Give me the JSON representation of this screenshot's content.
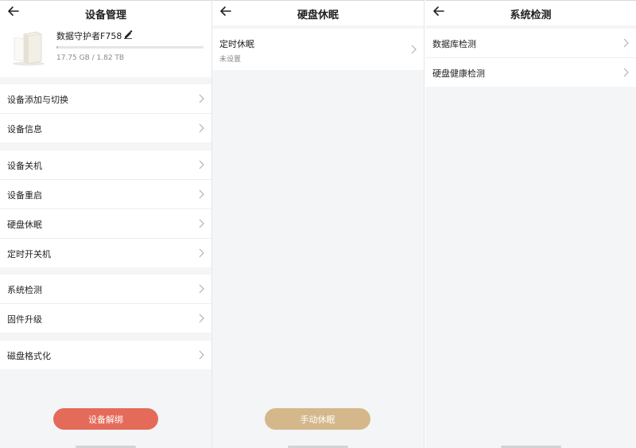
{
  "panels": {
    "device_management": {
      "title": "设备管理",
      "device": {
        "name": "数据守护者F758",
        "storage": "17.75 GB / 1.82 TB",
        "usage_fraction": 0.01
      },
      "groups": [
        [
          "设备添加与切换",
          "设备信息"
        ],
        [
          "设备关机",
          "设备重启",
          "硬盘休眠",
          "定时开关机"
        ],
        [
          "系统检测",
          "固件升级"
        ],
        [
          "磁盘格式化"
        ]
      ],
      "button": "设备解绑"
    },
    "disk_sleep": {
      "title": "硬盘休眠",
      "item": {
        "label": "定时休眠",
        "sub": "未设置"
      },
      "button": "手动休眠"
    },
    "system_check": {
      "title": "系统检测",
      "items": [
        "数据库检测",
        "硬盘健康检测"
      ]
    }
  },
  "colors": {
    "unbind_button": "#e46b5a",
    "sleep_button": "#d4b88b",
    "progress_fill": "#c9b98a"
  },
  "icons": {
    "back": "arrow-left-icon",
    "edit": "pencil-icon",
    "chevron": "chevron-right-icon",
    "device": "nas-device-icon"
  }
}
